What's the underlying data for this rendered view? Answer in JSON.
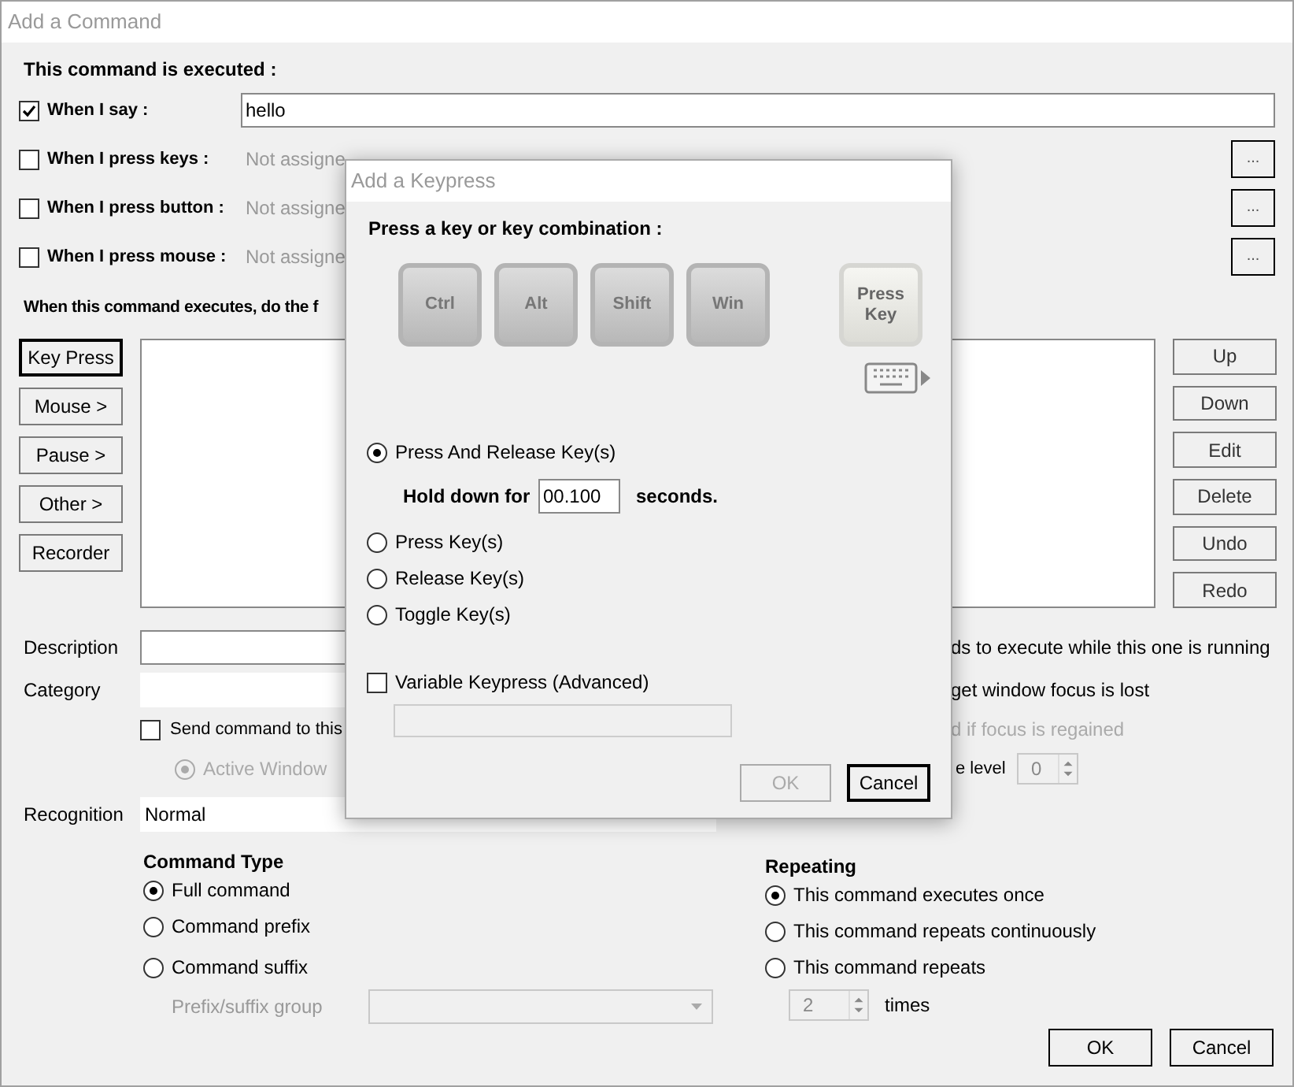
{
  "window": {
    "title": "Add a Command"
  },
  "triggers_heading": "This command is executed :",
  "triggers": [
    {
      "kind": "text",
      "label": "When I say :",
      "checked": true,
      "value": "hello"
    },
    {
      "kind": "assign",
      "label": "When I press keys :",
      "checked": false,
      "value": "Not assigne",
      "button": "..."
    },
    {
      "kind": "assign",
      "label": "When I press button :",
      "checked": false,
      "value": "Not assigne",
      "button": "..."
    },
    {
      "kind": "assign",
      "label": "When I press mouse :",
      "checked": false,
      "value": "Not assigne",
      "button": "..."
    }
  ],
  "actions_heading": "When this command executes, do the f",
  "action_buttons": [
    {
      "label": "Key Press",
      "focused": true
    },
    {
      "label": "Mouse >",
      "focused": false
    },
    {
      "label": "Pause >",
      "focused": false
    },
    {
      "label": "Other >",
      "focused": false
    },
    {
      "label": "Recorder",
      "focused": false
    }
  ],
  "list_buttons": [
    "Up",
    "Down",
    "Edit",
    "Delete",
    "Undo",
    "Redo"
  ],
  "description": {
    "label": "Description",
    "note": "ds to execute while this one is running"
  },
  "category": {
    "label": "Category",
    "note": "get window focus is lost"
  },
  "send_to": {
    "label": "Send command to this",
    "checked": false,
    "note": "d if focus is regained",
    "note_disabled": true
  },
  "active_window": {
    "label": "Active Window",
    "selected": true,
    "disabled": true,
    "note": "e level",
    "value": "0"
  },
  "recognition": {
    "label": "Recognition",
    "value": "Normal"
  },
  "command_type": {
    "heading": "Command Type",
    "options": [
      {
        "label": "Full command",
        "selected": true
      },
      {
        "label": "Command prefix",
        "selected": false
      },
      {
        "label": "Command suffix",
        "selected": false
      }
    ],
    "group_label": "Prefix/suffix group"
  },
  "repeating": {
    "heading": "Repeating",
    "options": [
      {
        "label": "This command executes once",
        "selected": true
      },
      {
        "label": "This command repeats continuously",
        "selected": false
      },
      {
        "label": "This command repeats",
        "selected": false
      }
    ],
    "count": "2",
    "unit": "times"
  },
  "buttons": [
    "OK",
    "Cancel"
  ],
  "dialog": {
    "title": "Add a Keypress",
    "heading": "Press a key or key combination :",
    "keys": [
      "Ctrl",
      "Alt",
      "Shift",
      "Win"
    ],
    "press_key": "Press Key",
    "modes": [
      {
        "label": "Press And Release Key(s)",
        "selected": true
      },
      {
        "label": "Press Key(s)",
        "selected": false
      },
      {
        "label": "Release Key(s)",
        "selected": false
      },
      {
        "label": "Toggle Key(s)",
        "selected": false
      }
    ],
    "hold": {
      "label": "Hold down for",
      "value": "00.100",
      "unit": "seconds."
    },
    "variable": {
      "label": "Variable Keypress (Advanced)",
      "checked": false
    },
    "ok": {
      "label": "OK",
      "disabled": true
    },
    "cancel": {
      "label": "Cancel"
    }
  }
}
